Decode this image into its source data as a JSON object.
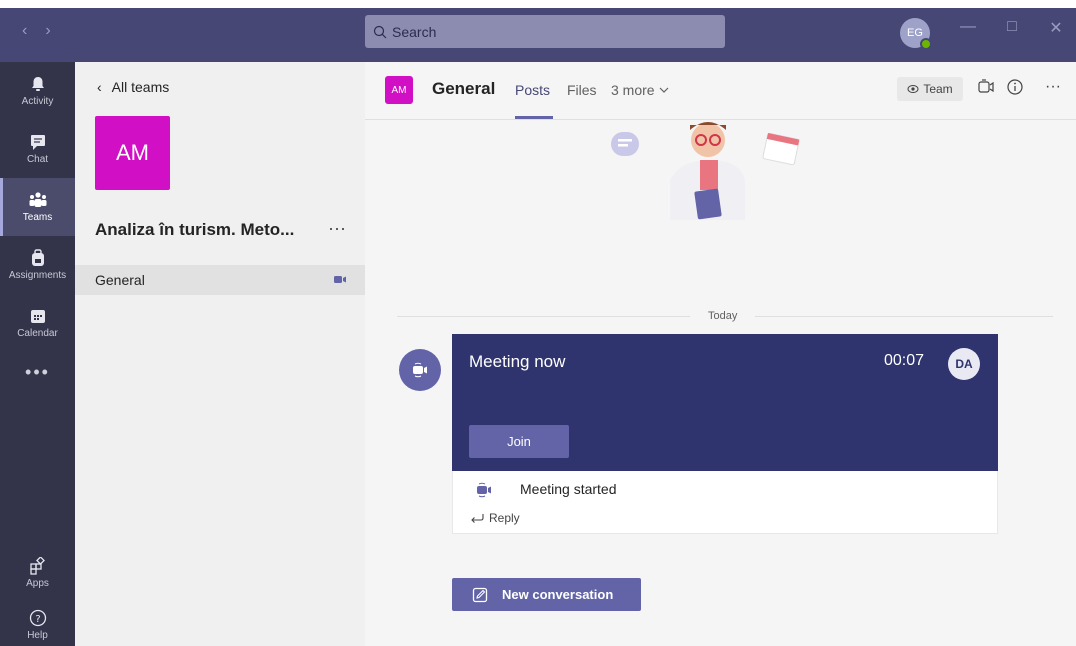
{
  "titlebar": {
    "search_placeholder": "Search",
    "user_initials": "EG"
  },
  "rail": {
    "items": [
      {
        "label": "Activity",
        "icon": "bell-icon"
      },
      {
        "label": "Chat",
        "icon": "chat-icon"
      },
      {
        "label": "Teams",
        "icon": "teams-icon",
        "active": true
      },
      {
        "label": "Assignments",
        "icon": "backpack-icon"
      },
      {
        "label": "Calendar",
        "icon": "calendar-icon"
      }
    ],
    "more": "•••",
    "bottom": [
      {
        "label": "Apps",
        "icon": "apps-icon"
      },
      {
        "label": "Help",
        "icon": "help-icon"
      }
    ]
  },
  "team_panel": {
    "back_label": "All teams",
    "team_initials": "AM",
    "team_name": "Analiza în turism. Meto...",
    "more": "···",
    "channels": [
      {
        "name": "General",
        "active": true,
        "meeting_icon": "video-camera-icon"
      }
    ]
  },
  "header": {
    "avatar_initials": "AM",
    "channel_title": "General",
    "tabs": [
      "Posts",
      "Files",
      "3 more"
    ],
    "active_tab": "Posts",
    "team_button": "Team",
    "more": "···"
  },
  "feed": {
    "divider_label": "Today",
    "meeting": {
      "title": "Meeting now",
      "duration": "00:07",
      "participant_initials": "DA",
      "join_label": "Join",
      "started_text": "Meeting started",
      "reply_label": "Reply"
    },
    "new_conversation_label": "New conversation"
  },
  "colors": {
    "titlebar": "#464775",
    "rail": "#33344a",
    "accent": "#6264a7",
    "meeting_card": "#2f336e",
    "team_avatar": "#d10fc4"
  }
}
